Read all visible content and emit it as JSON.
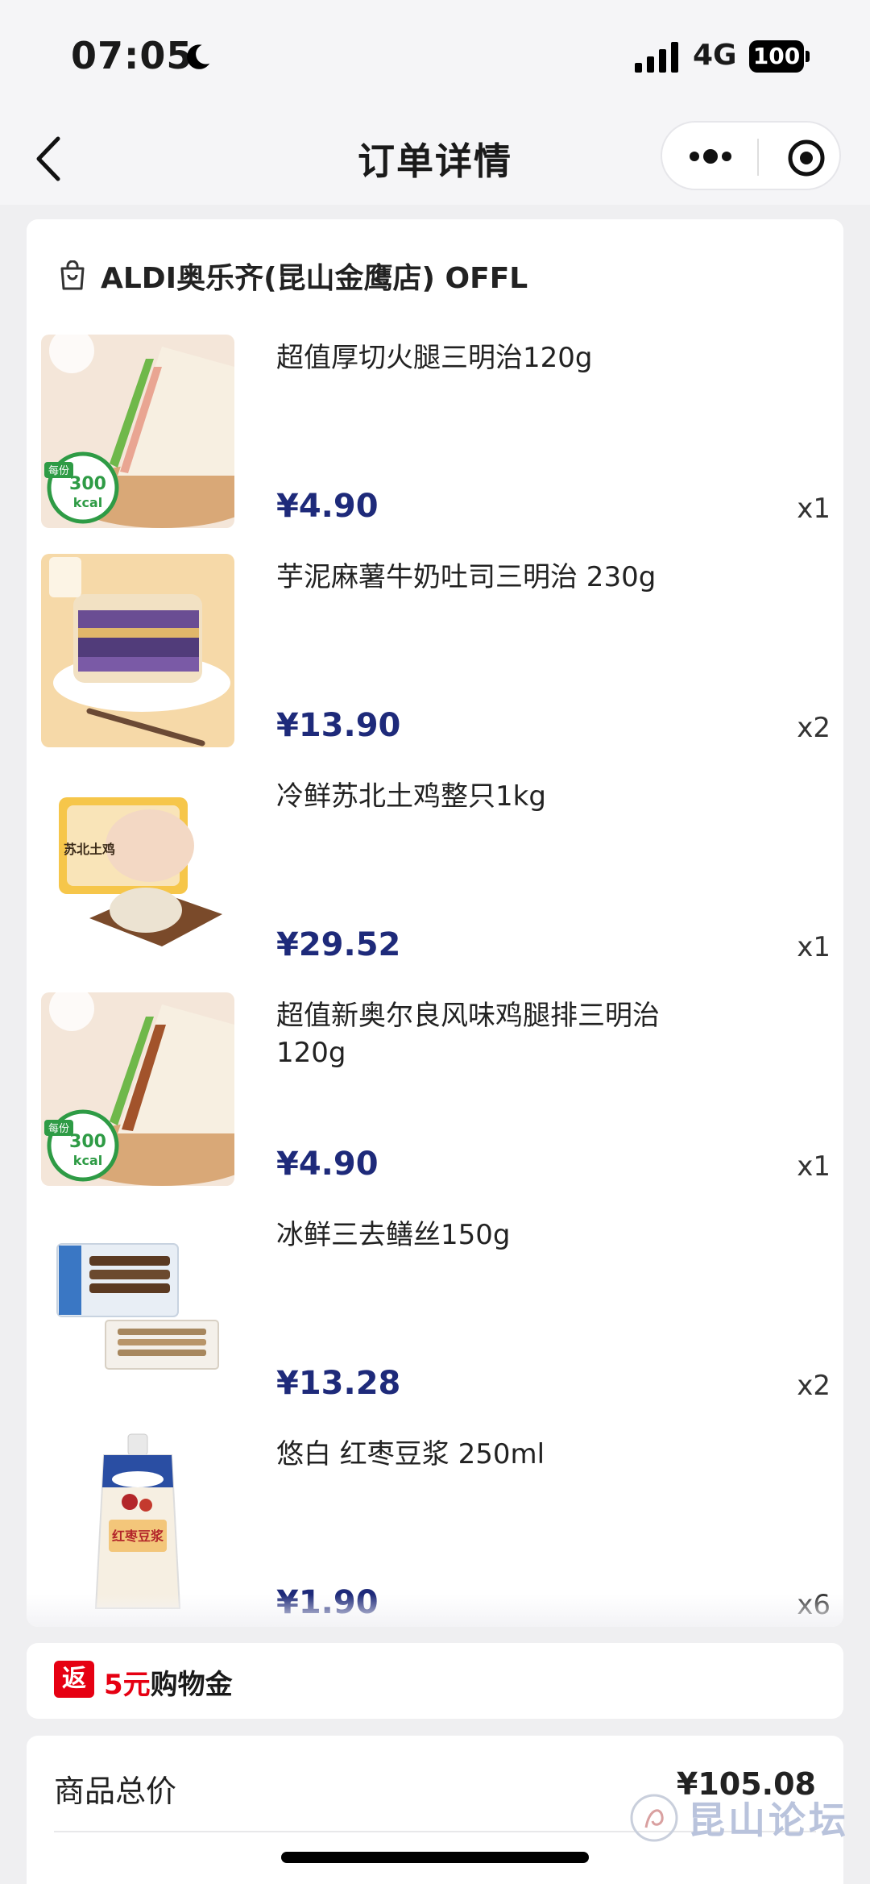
{
  "status_bar": {
    "time": "07:05",
    "network": "4G",
    "battery": "100"
  },
  "nav": {
    "title": "订单详情"
  },
  "store": {
    "name": "ALDI奥乐齐(昆山金鹰店) OFFL"
  },
  "items": [
    {
      "name": "超值厚切火腿三明治120g",
      "price": "¥4.90",
      "qty": "x1",
      "thumb": "ham-sandwich-image",
      "badge_top": "每份",
      "badge_num": "300",
      "badge_unit": "kcal"
    },
    {
      "name": "芋泥麻薯牛奶吐司三明治 230g",
      "price": "¥13.90",
      "qty": "x2",
      "thumb": "taro-toast-sandwich-image"
    },
    {
      "name": "冷鲜苏北土鸡整只1kg",
      "price": "¥29.52",
      "qty": "x1",
      "thumb": "whole-chicken-image",
      "pack_label": "苏北土鸡"
    },
    {
      "name": "超值新奥尔良风味鸡腿排三明治120g",
      "price": "¥4.90",
      "qty": "x1",
      "thumb": "chicken-sandwich-image",
      "badge_top": "每份",
      "badge_num": "300",
      "badge_unit": "kcal"
    },
    {
      "name": "冰鲜三去鳝丝150g",
      "price": "¥13.28",
      "qty": "x2",
      "thumb": "eel-shreds-image"
    },
    {
      "name": "悠白 红枣豆浆 250ml",
      "price": "¥1.90",
      "qty": "x6",
      "thumb": "soy-milk-pouch-image",
      "pack_label": "红枣豆浆"
    }
  ],
  "coupon": {
    "badge": "返",
    "amount": "5元",
    "text": "购物金"
  },
  "summary": {
    "label": "商品总价",
    "value": "¥105.08"
  },
  "watermark": {
    "text": "昆山论坛"
  },
  "colors": {
    "price": "#1e2a7a",
    "accent_red": "#e60012",
    "page_bg": "#efeff1"
  }
}
